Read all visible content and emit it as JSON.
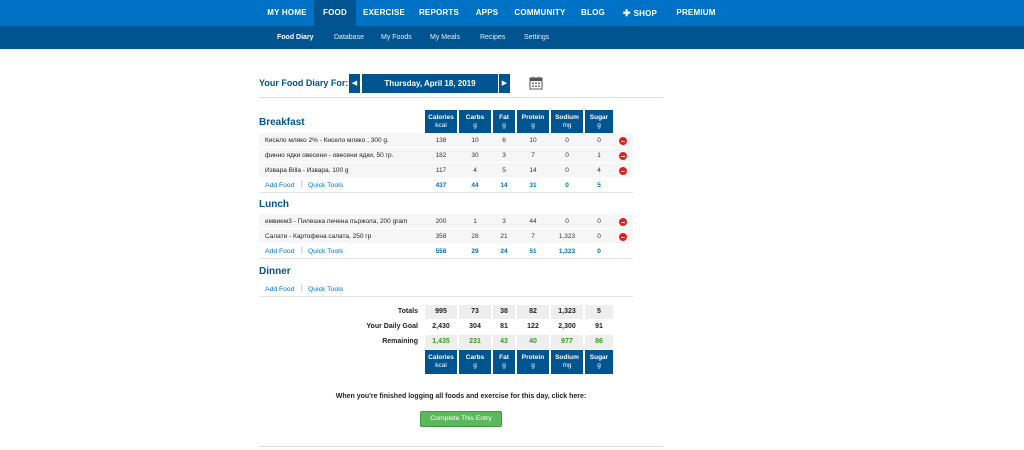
{
  "top_nav": [
    "MY HOME",
    "FOOD",
    "EXERCISE",
    "REPORTS",
    "APPS",
    "COMMUNITY",
    "BLOG",
    "SHOP",
    "PREMIUM"
  ],
  "sub_nav": [
    "Food Diary",
    "Database",
    "My Foods",
    "My Meals",
    "Recipes",
    "Settings"
  ],
  "diary": {
    "title": "Your Food Diary For:",
    "date": "Thursday, April 18, 2019",
    "prev_arrow": "◀",
    "next_arrow": "▶"
  },
  "columns": [
    {
      "name": "Calories",
      "unit": "kcal"
    },
    {
      "name": "Carbs",
      "unit": "g"
    },
    {
      "name": "Fat",
      "unit": "g"
    },
    {
      "name": "Protein",
      "unit": "g"
    },
    {
      "name": "Sodium",
      "unit": "mg"
    },
    {
      "name": "Sugar",
      "unit": "g"
    }
  ],
  "links": {
    "add_food": "Add Food",
    "quick_tools": "Quick Tools",
    "separator": "|"
  },
  "meals": {
    "breakfast": {
      "title": "Breakfast",
      "rows": [
        {
          "name": "Кисело мляко 2% - Кисело мляко , 300 g.",
          "values": [
            "138",
            "10",
            "6",
            "10",
            "0",
            "0"
          ]
        },
        {
          "name": "финно ядки овесени - овесени ядки, 50 гр.",
          "values": [
            "182",
            "30",
            "3",
            "7",
            "0",
            "1"
          ]
        },
        {
          "name": "Извара Billa - Извара, 100 g",
          "values": [
            "117",
            "4",
            "5",
            "14",
            "0",
            "4"
          ]
        }
      ],
      "totals": [
        "437",
        "44",
        "14",
        "31",
        "0",
        "5"
      ]
    },
    "lunch": {
      "title": "Lunch",
      "rows": [
        {
          "name": "емвием3 - Пилешка печена пържола, 200 gram",
          "values": [
            "200",
            "1",
            "3",
            "44",
            "0",
            "0"
          ]
        },
        {
          "name": "Салати - Картофена салата, 250 гр",
          "values": [
            "358",
            "28",
            "21",
            "7",
            "1,323",
            "0"
          ]
        }
      ],
      "totals": [
        "558",
        "29",
        "24",
        "51",
        "1,323",
        "0"
      ]
    },
    "dinner": {
      "title": "Dinner"
    }
  },
  "summary": {
    "totals": {
      "label": "Totals",
      "values": [
        "995",
        "73",
        "38",
        "82",
        "1,323",
        "5"
      ]
    },
    "goal": {
      "label": "Your Daily Goal",
      "values": [
        "2,430",
        "304",
        "81",
        "122",
        "2,300",
        "91"
      ]
    },
    "remaining": {
      "label": "Remaining",
      "values": [
        "1,435",
        "231",
        "43",
        "40",
        "977",
        "86"
      ]
    }
  },
  "finish": {
    "text": "When you're finished logging all foods and exercise for this day, click here:",
    "button": "Complete This Entry"
  },
  "colors": {
    "nav": "#0072c6",
    "subnav": "#00548f",
    "remaining": "#3a9a1a",
    "complete_button": "#5cb85c",
    "remove_icon": "#e02020"
  }
}
